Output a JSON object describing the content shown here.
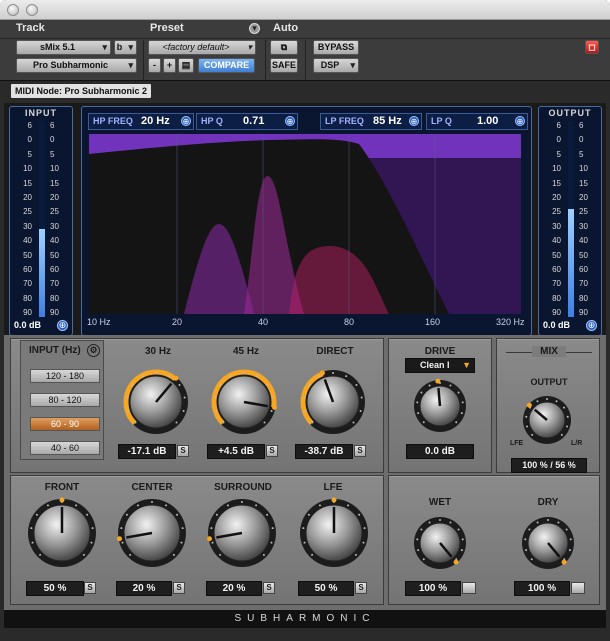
{
  "window": {
    "traffic_lights": [
      "close",
      "minimize",
      "zoom"
    ]
  },
  "header": {
    "track_label": "Track",
    "preset_label": "Preset",
    "auto_label": "Auto",
    "track_select": "sMix 5.1",
    "track_channel": "b",
    "insert_select": "Pro Subharmonic",
    "preset_select": "<factory default>",
    "preset_minus": "-",
    "preset_plus": "+",
    "compare": "COMPARE",
    "safe": "SAFE",
    "bypass": "BYPASS",
    "dsp": "DSP",
    "midi_node": "MIDI Node: Pro Subharmonic 2"
  },
  "input_meter": {
    "title": "INPUT",
    "value": "0.0 dB",
    "scale": [
      "6",
      "0",
      "5",
      "10",
      "15",
      "20",
      "25",
      "30",
      "40",
      "50",
      "60",
      "70",
      "80",
      "90"
    ],
    "level": 0.45
  },
  "output_meter": {
    "title": "OUTPUT",
    "value": "0.0 dB",
    "scale": [
      "6",
      "0",
      "5",
      "10",
      "15",
      "20",
      "25",
      "30",
      "40",
      "50",
      "60",
      "70",
      "80",
      "90"
    ],
    "level": 0.55
  },
  "eq": {
    "hp_freq_label": "HP FREQ",
    "hp_freq_value": "20 Hz",
    "hp_q_label": "HP Q",
    "hp_q_value": "0.71",
    "lp_freq_label": "LP FREQ",
    "lp_freq_value": "85 Hz",
    "lp_q_label": "LP Q",
    "lp_q_value": "1.00",
    "freq_labels": [
      "10 Hz",
      "20",
      "40",
      "80",
      "160",
      "320 Hz"
    ]
  },
  "input_range": {
    "title": "INPUT (Hz)",
    "options": [
      "120 - 180",
      "80 - 120",
      "60 - 90",
      "40 - 60"
    ],
    "selected": 2
  },
  "bands": [
    {
      "label": "30 Hz",
      "value": "-17.1 dB",
      "s": "S"
    },
    {
      "label": "45 Hz",
      "value": "+4.5 dB",
      "s": "S"
    },
    {
      "label": "DIRECT",
      "value": "-38.7 dB",
      "s": "S"
    }
  ],
  "drive": {
    "label": "DRIVE",
    "mode": "Clean I",
    "value": "0.0 dB"
  },
  "mix": {
    "title": "MIX",
    "output_label": "OUTPUT",
    "lfe": "LFE",
    "lr": "L/R",
    "value": "100 % / 56 %"
  },
  "channels": [
    {
      "label": "FRONT",
      "value": "50 %",
      "s": "S"
    },
    {
      "label": "CENTER",
      "value": "20 %",
      "s": "S"
    },
    {
      "label": "SURROUND",
      "value": "20 %",
      "s": "S"
    },
    {
      "label": "LFE",
      "value": "50 %",
      "s": "S"
    }
  ],
  "wetdry": [
    {
      "label": "WET",
      "value": "100 %"
    },
    {
      "label": "DRY",
      "value": "100 %"
    }
  ],
  "footer": "SUBHARMONIC",
  "colors": {
    "accent": "#f5a623",
    "meter_blue": "#4a8ff0",
    "eq_purple": "#7a2bd6",
    "eq_magenta": "#c8208a"
  }
}
